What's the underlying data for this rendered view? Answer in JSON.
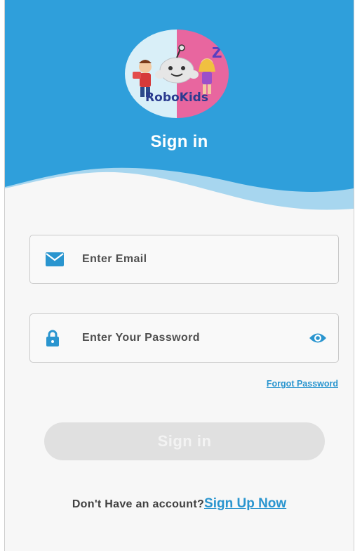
{
  "brand": {
    "logo_text": "RoboKids"
  },
  "header": {
    "title": "Sign in"
  },
  "form": {
    "email": {
      "placeholder": "Enter Email",
      "value": ""
    },
    "password": {
      "placeholder": "Enter Your Password",
      "value": ""
    },
    "forgot_label": "Forgot Password",
    "submit_label": "Sign in"
  },
  "footer": {
    "prompt": "Don't Have an account?",
    "signup_label": "Sign Up Now"
  },
  "icons": {
    "email": "envelope-icon",
    "password": "lock-icon",
    "toggle": "eye-icon"
  },
  "colors": {
    "primary": "#2f9fdb",
    "link": "#2a95cf",
    "button_disabled": "#e0e0e0",
    "logo_pink": "#e8669f",
    "logo_light": "#d9eff8"
  }
}
